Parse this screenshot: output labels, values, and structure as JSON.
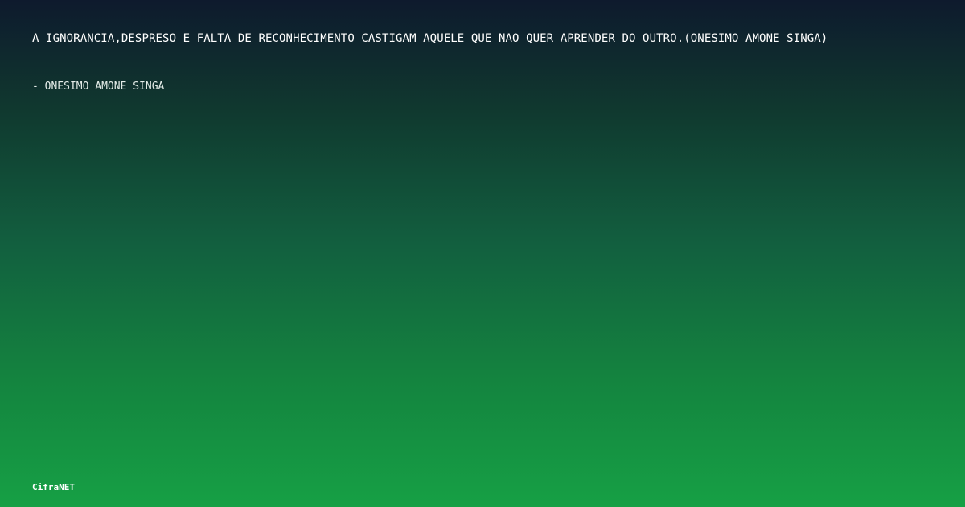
{
  "quote": {
    "text": "A IGNORANCIA,DESPRESO E FALTA DE RECONHECIMENTO CASTIGAM AQUELE QUE NAO QUER APRENDER DO OUTRO.(ONESIMO AMONE SINGA)",
    "author": "- ONESIMO AMONE SINGA"
  },
  "footer": {
    "brand": "CifraNET"
  },
  "colors": {
    "gradient_top": "#0e1a2d",
    "gradient_bottom": "#16a045",
    "text": "#ffffff"
  }
}
